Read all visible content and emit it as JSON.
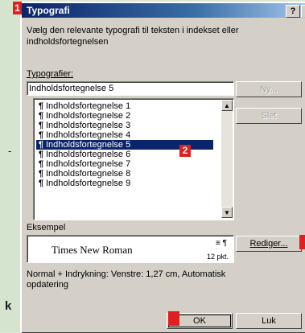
{
  "background": {
    "dash_fragment": "-",
    "k_fragment": "k"
  },
  "markers": {
    "m1": "1",
    "m2": "2"
  },
  "dialog": {
    "title": "Typografi",
    "help": "?",
    "description": "Vælg den relevante typografi til teksten i indekset eller indholdsfortegnelsen",
    "styles_label": "Typografier:",
    "styles_value": "Indholdsfortegnelse 5",
    "list_items": [
      "Indholdsfortegnelse 1",
      "Indholdsfortegnelse 2",
      "Indholdsfortegnelse 3",
      "Indholdsfortegnelse 4",
      "Indholdsfortegnelse 5",
      "Indholdsfortegnelse 6",
      "Indholdsfortegnelse 7",
      "Indholdsfortegnelse 8",
      "Indholdsfortegnelse 9"
    ],
    "selected_index": 4,
    "pilcrow": "¶",
    "new_button": "Ny...",
    "delete_button": "Slet",
    "example_label": "Eksempel",
    "preview_font": "Times New Roman",
    "preview_size": "12 pkt.",
    "preview_marks": "≡ ¶",
    "modify_button": "Rediger...",
    "style_description": "Normal + Indrykning: Venstre:  1,27 cm, Automatisk opdatering",
    "ok_button": "OK",
    "close_button": "Luk",
    "colors": {
      "titlebar": "#0a246a",
      "selection": "#0a246a",
      "marker": "#e02020"
    }
  }
}
